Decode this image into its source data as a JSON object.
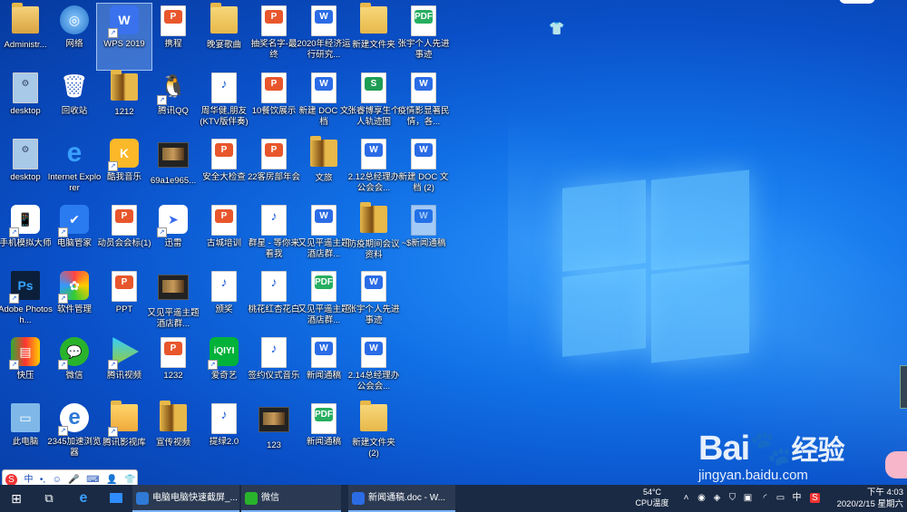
{
  "desktop": {
    "icons": [
      {
        "label": "Administr...",
        "col": 0,
        "row": 0,
        "glyph": "user",
        "shortcut": false
      },
      {
        "label": "网络",
        "col": 1,
        "row": 0,
        "glyph": "network",
        "shortcut": false
      },
      {
        "label": "WPS 2019",
        "col": 2,
        "row": 0,
        "glyph": "wps",
        "shortcut": true,
        "selected": true
      },
      {
        "label": "携程",
        "col": 3,
        "row": 0,
        "glyph": "ppt",
        "shortcut": false
      },
      {
        "label": "晚宴歌曲",
        "col": 4,
        "row": 0,
        "glyph": "folder",
        "shortcut": false
      },
      {
        "label": "抽奖名字-最终",
        "col": 5,
        "row": 0,
        "glyph": "ppt",
        "shortcut": false
      },
      {
        "label": "2020年经济运行研究...",
        "col": 6,
        "row": 0,
        "glyph": "doc",
        "shortcut": false
      },
      {
        "label": "新建文件夹",
        "col": 7,
        "row": 0,
        "glyph": "folder",
        "shortcut": false
      },
      {
        "label": "张宇个人先进事迹",
        "col": 8,
        "row": 0,
        "glyph": "pdf",
        "shortcut": false
      },
      {
        "label": "desktop",
        "col": 0,
        "row": 1,
        "glyph": "gear",
        "shortcut": false
      },
      {
        "label": "回收站",
        "col": 1,
        "row": 1,
        "glyph": "recycle",
        "shortcut": false
      },
      {
        "label": "1212",
        "col": 2,
        "row": 1,
        "glyph": "zip",
        "shortcut": false
      },
      {
        "label": "腾讯QQ",
        "col": 3,
        "row": 1,
        "glyph": "qq",
        "shortcut": true
      },
      {
        "label": "周华健,朋友 (KTV版伴奏)",
        "col": 4,
        "row": 1,
        "glyph": "mp3",
        "shortcut": false
      },
      {
        "label": "10餐饮展示",
        "col": 5,
        "row": 1,
        "glyph": "ppt",
        "shortcut": false
      },
      {
        "label": "新建 DOC 文档",
        "col": 6,
        "row": 1,
        "glyph": "doc",
        "shortcut": false
      },
      {
        "label": "张睿博享生个人轨迹图",
        "col": 7,
        "row": 1,
        "glyph": "xls",
        "shortcut": false
      },
      {
        "label": "疫情影显著民情，各...",
        "col": 8,
        "row": 1,
        "glyph": "doc",
        "shortcut": false
      },
      {
        "label": "desktop",
        "col": 0,
        "row": 2,
        "glyph": "gear",
        "shortcut": false
      },
      {
        "label": "Internet Explorer",
        "col": 1,
        "row": 2,
        "glyph": "ie",
        "shortcut": false
      },
      {
        "label": "酷我音乐",
        "col": 2,
        "row": 2,
        "glyph": "kuwo",
        "shortcut": true
      },
      {
        "label": "69a1e965...",
        "col": 3,
        "row": 2,
        "glyph": "film",
        "shortcut": false
      },
      {
        "label": "安全大检查",
        "col": 4,
        "row": 2,
        "glyph": "ppt",
        "shortcut": false
      },
      {
        "label": "22客房部年会",
        "col": 5,
        "row": 2,
        "glyph": "ppt",
        "shortcut": false
      },
      {
        "label": "文旅",
        "col": 6,
        "row": 2,
        "glyph": "zip",
        "shortcut": false
      },
      {
        "label": "2.12总经理办公会会...",
        "col": 7,
        "row": 2,
        "glyph": "doc",
        "shortcut": false
      },
      {
        "label": "新建 DOC 文档 (2)",
        "col": 8,
        "row": 2,
        "glyph": "doc",
        "shortcut": false
      },
      {
        "label": "手机模拟大师",
        "col": 0,
        "row": 3,
        "glyph": "phone",
        "shortcut": true
      },
      {
        "label": "电脑管家",
        "col": 1,
        "row": 3,
        "glyph": "guard",
        "shortcut": true
      },
      {
        "label": "动员会会标(1)",
        "col": 2,
        "row": 3,
        "glyph": "ppt",
        "shortcut": false
      },
      {
        "label": "迅雷",
        "col": 3,
        "row": 3,
        "glyph": "xunlei",
        "shortcut": true
      },
      {
        "label": "古城培训",
        "col": 4,
        "row": 3,
        "glyph": "ppt",
        "shortcut": false
      },
      {
        "label": "群星 - 等你来看我",
        "col": 5,
        "row": 3,
        "glyph": "mp3",
        "shortcut": false
      },
      {
        "label": "又见平遥主题酒店群...",
        "col": 6,
        "row": 3,
        "glyph": "doc",
        "shortcut": false
      },
      {
        "label": "防疫期间会议资料",
        "col": 7,
        "row": 3,
        "glyph": "zip",
        "shortcut": false
      },
      {
        "label": "~$新闻通稿",
        "col": 8,
        "row": 3,
        "glyph": "docfade",
        "shortcut": false
      },
      {
        "label": "Adobe Photosh...",
        "col": 0,
        "row": 4,
        "glyph": "ps",
        "shortcut": true
      },
      {
        "label": "软件管理",
        "col": 1,
        "row": 4,
        "glyph": "softmgr",
        "shortcut": true
      },
      {
        "label": "PPT",
        "col": 2,
        "row": 4,
        "glyph": "ppt",
        "shortcut": false
      },
      {
        "label": "又见平遥主题酒店群...",
        "col": 3,
        "row": 4,
        "glyph": "film",
        "shortcut": false
      },
      {
        "label": "颁奖",
        "col": 4,
        "row": 4,
        "glyph": "mp3",
        "shortcut": false
      },
      {
        "label": "桃花红杏花白",
        "col": 5,
        "row": 4,
        "glyph": "mp3",
        "shortcut": false
      },
      {
        "label": "又见平遥主题酒店群...",
        "col": 6,
        "row": 4,
        "glyph": "pdf",
        "shortcut": false
      },
      {
        "label": "张宇个人先进事迹",
        "col": 7,
        "row": 4,
        "glyph": "doc",
        "shortcut": false
      },
      {
        "label": "快压",
        "col": 0,
        "row": 5,
        "glyph": "kuaiya",
        "shortcut": true
      },
      {
        "label": "微信",
        "col": 1,
        "row": 5,
        "glyph": "wechat",
        "shortcut": true
      },
      {
        "label": "腾讯视频",
        "col": 2,
        "row": 5,
        "glyph": "txvideo",
        "shortcut": true
      },
      {
        "label": "1232",
        "col": 3,
        "row": 5,
        "glyph": "ppt",
        "shortcut": false
      },
      {
        "label": "爱奇艺",
        "col": 4,
        "row": 5,
        "glyph": "iqiyi",
        "shortcut": true
      },
      {
        "label": "签约仪式音乐",
        "col": 5,
        "row": 5,
        "glyph": "mp3",
        "shortcut": false
      },
      {
        "label": "新闻通稿",
        "col": 6,
        "row": 5,
        "glyph": "doc",
        "shortcut": false
      },
      {
        "label": "2.14总经理办公会会...",
        "col": 7,
        "row": 5,
        "glyph": "doc",
        "shortcut": false
      },
      {
        "label": "此电脑",
        "col": 0,
        "row": 6,
        "glyph": "pc",
        "shortcut": false
      },
      {
        "label": "2345加速浏览器",
        "col": 1,
        "row": 6,
        "glyph": "ie2345",
        "shortcut": true
      },
      {
        "label": "腾讯影视库",
        "col": 2,
        "row": 6,
        "glyph": "txlib",
        "shortcut": true
      },
      {
        "label": "宣传视频",
        "col": 3,
        "row": 6,
        "glyph": "zip",
        "shortcut": false
      },
      {
        "label": "提绿2.0",
        "col": 4,
        "row": 6,
        "glyph": "mp3",
        "shortcut": false
      },
      {
        "label": "123",
        "col": 5,
        "row": 6,
        "glyph": "film",
        "shortcut": false
      },
      {
        "label": "新闻通稿",
        "col": 6,
        "row": 6,
        "glyph": "pdf",
        "shortcut": false
      },
      {
        "label": "新建文件夹 (2)",
        "col": 7,
        "row": 6,
        "glyph": "folder",
        "shortcut": false
      }
    ]
  },
  "ime": {
    "lang": "中",
    "punct": "•,"
  },
  "taskbar": {
    "tasks": [
      {
        "label": "电脑电脑快速截屏_...",
        "color": "#2f7ad6"
      },
      {
        "label": "微信",
        "color": "#29b32c"
      },
      {
        "label": "新闻通稿.doc - W...",
        "color": "#2b6ce6"
      }
    ],
    "cpu_temp": "54°C",
    "cpu_label": "CPU温度",
    "ime_lang": "中",
    "time": "下午 4:03",
    "date": "2020/2/15 星期六"
  },
  "watermark": {
    "brand": "Bai",
    "brand2": "经验",
    "url": "jingyan.baidu.com"
  },
  "colors": {
    "accent": "#1a5ad7",
    "taskbar": "#1a2a44",
    "ppt": "#e8562c",
    "doc": "#2b6ce6",
    "pdf": "#27ae60",
    "xls": "#1f9d55"
  }
}
